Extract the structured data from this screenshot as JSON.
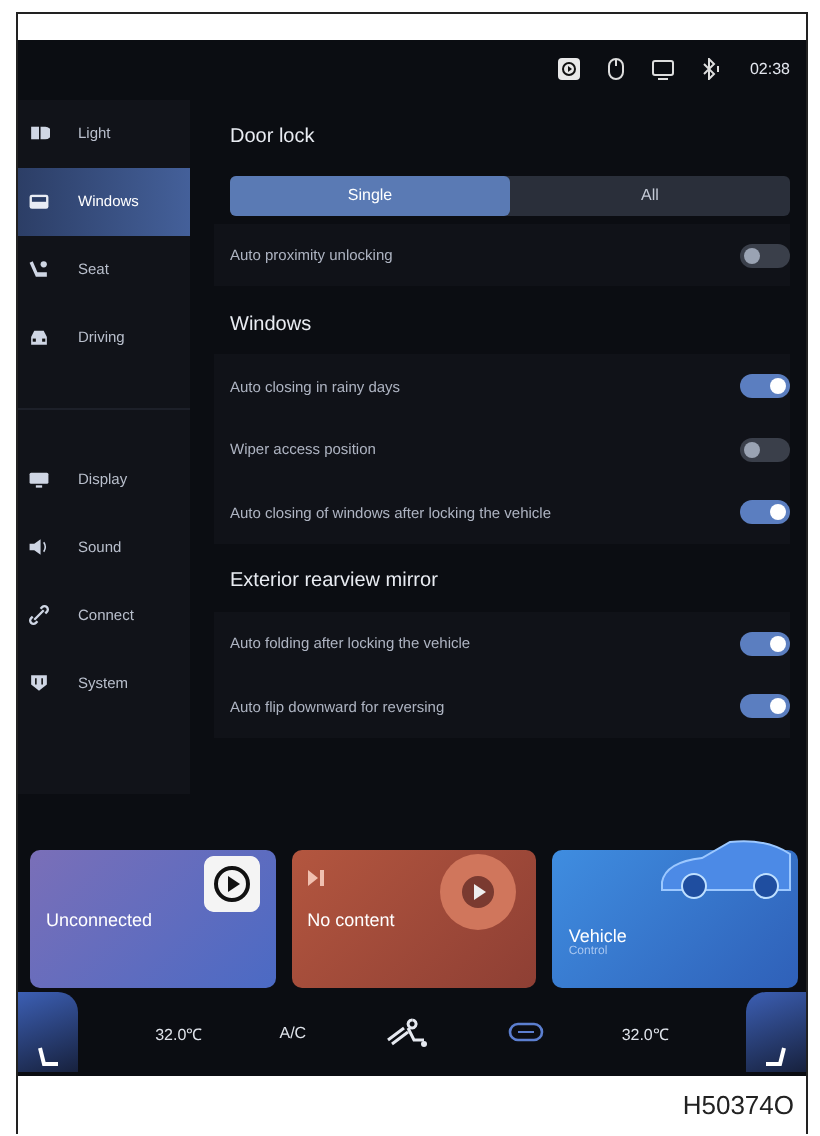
{
  "status_bar": {
    "time": "02:38"
  },
  "sidebar": {
    "groups": [
      {
        "items": [
          {
            "label": "Light",
            "selected": false
          },
          {
            "label": "Windows",
            "selected": true
          },
          {
            "label": "Seat",
            "selected": false
          },
          {
            "label": "Driving",
            "selected": false
          }
        ]
      },
      {
        "items": [
          {
            "label": "Display",
            "selected": false
          },
          {
            "label": "Sound",
            "selected": false
          },
          {
            "label": "Connect",
            "selected": false
          },
          {
            "label": "System",
            "selected": false
          }
        ]
      }
    ]
  },
  "sections": [
    {
      "title": "Door lock",
      "segments": [
        {
          "label": "Single",
          "selected": true
        },
        {
          "label": "All",
          "selected": false
        }
      ],
      "rows": [
        {
          "label": "Auto proximity unlocking",
          "on": false
        }
      ]
    },
    {
      "title": "Windows",
      "rows": [
        {
          "label": "Auto closing in rainy days",
          "on": true
        },
        {
          "label": "Wiper access position",
          "on": false
        },
        {
          "label": "Auto closing of windows after locking the vehicle",
          "on": true
        }
      ]
    },
    {
      "title": "Exterior rearview mirror",
      "rows": [
        {
          "label": "Auto folding after locking the vehicle",
          "on": true
        },
        {
          "label": "Auto flip downward for reversing",
          "on": true
        }
      ]
    }
  ],
  "cards": [
    {
      "kind": "phone",
      "title": "Unconnected"
    },
    {
      "kind": "media",
      "title": "No content"
    },
    {
      "kind": "vehicle",
      "title": "Vehicle",
      "subtitle": "Control"
    }
  ],
  "climate": {
    "left_temp": "32.0℃",
    "ac": "A/C",
    "right_temp": "32.0℃"
  },
  "figure_code": "H50374O"
}
